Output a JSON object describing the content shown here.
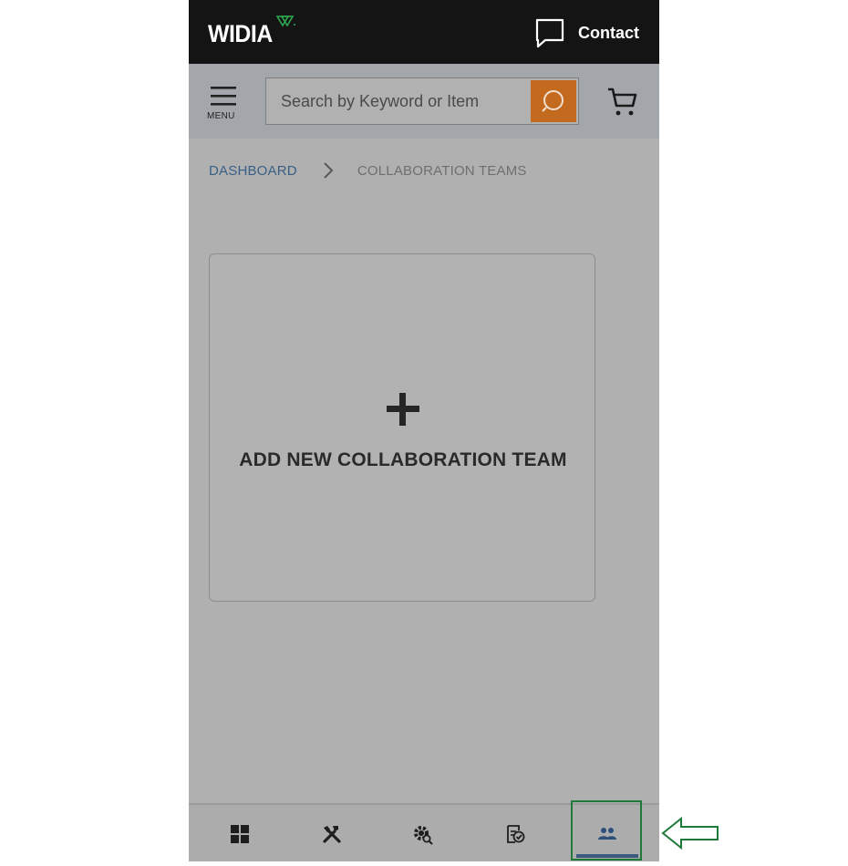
{
  "header": {
    "logo_text": "WIDIA",
    "contact_label": "Contact"
  },
  "search": {
    "menu_label": "MENU",
    "placeholder": "Search by Keyword or Item"
  },
  "breadcrumb": {
    "items": [
      "DASHBOARD",
      "COLLABORATION TEAMS"
    ]
  },
  "main": {
    "add_card_label": "ADD NEW COLLABORATION TEAM"
  },
  "bottom_nav": {
    "items": [
      {
        "icon": "dashboard-grid-icon"
      },
      {
        "icon": "tools-icon"
      },
      {
        "icon": "gear-search-icon"
      },
      {
        "icon": "checklist-icon"
      },
      {
        "icon": "people-icon",
        "active": true
      }
    ]
  },
  "colors": {
    "header_bg": "#141414",
    "accent_orange": "#c46a1f",
    "link_blue": "#3a5f86",
    "highlight_green": "#1e7a3a"
  }
}
